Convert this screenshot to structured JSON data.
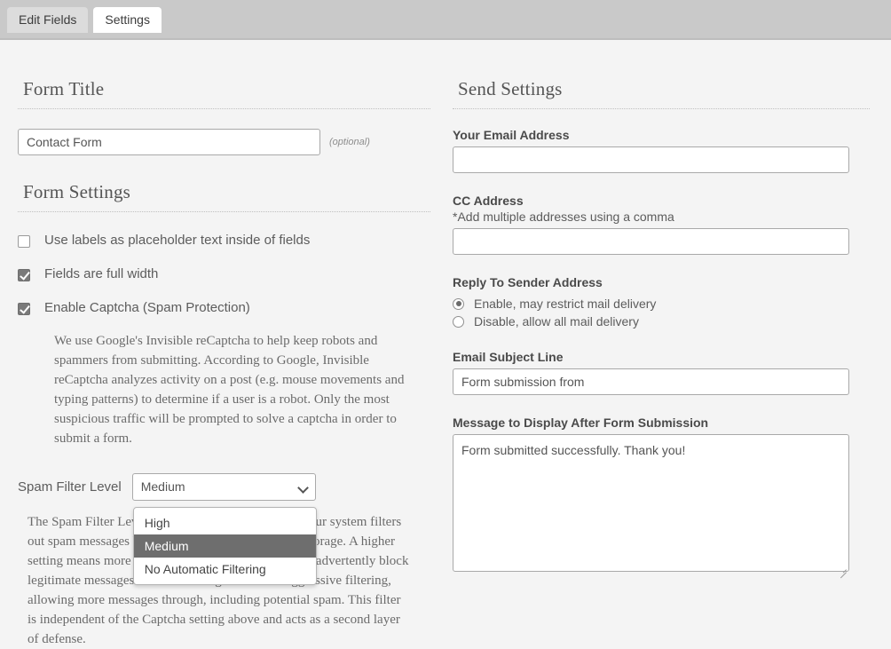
{
  "tabs": [
    {
      "label": "Edit Fields",
      "active": false
    },
    {
      "label": "Settings",
      "active": true
    }
  ],
  "left": {
    "form_title": {
      "heading": "Form Title",
      "value": "Contact Form",
      "optional_note": "(optional)"
    },
    "form_settings": {
      "heading": "Form Settings",
      "checkboxes": [
        {
          "label": "Use labels as placeholder text inside of fields",
          "checked": false
        },
        {
          "label": "Fields are full width",
          "checked": true
        },
        {
          "label": "Enable Captcha (Spam Protection)",
          "checked": true
        }
      ],
      "captcha_help": "We use Google's Invisible reCaptcha to help keep robots and spammers from submitting. According to Google, Invisible reCaptcha analyzes activity on a post (e.g. mouse movements and typing patterns) to determine if a user is a robot. Only the most suspicious traffic will be prompted to solve a captcha in order to submit a form.",
      "spam_filter": {
        "label": "Spam Filter Level",
        "selected": "Medium",
        "options": [
          "High",
          "Medium",
          "No Automatic Filtering"
        ],
        "open": true,
        "help": "The Spam Filter Level determines how aggressively our system filters out spam messages before they reach your inbox or storage. A higher setting means more aggressive filtering, which may inadvertently block legitimate messages. A lower setting means less aggressive filtering, allowing more messages through, including potential spam. This filter is independent of the Captcha setting above and acts as a second layer of defense."
      }
    }
  },
  "right": {
    "heading": "Send Settings",
    "your_email": {
      "label": "Your Email Address",
      "value": "",
      "placeholder": ""
    },
    "cc_address": {
      "label": "CC Address",
      "sub_label": "*Add multiple addresses using a comma",
      "value": "",
      "placeholder": ""
    },
    "reply_to": {
      "label": "Reply To Sender Address",
      "options": [
        {
          "label": "Enable, may restrict mail delivery",
          "selected": true
        },
        {
          "label": "Disable, allow all mail delivery",
          "selected": false
        }
      ]
    },
    "subject_line": {
      "label": "Email Subject Line",
      "value": "Form submission from"
    },
    "message": {
      "label": "Message to Display After Form Submission",
      "value": "Form submitted successfully. Thank you!"
    }
  },
  "colors": {
    "page_bg": "#f4f4f4",
    "tabbar_bg": "#c9c9c9",
    "tab_active_bg": "#ffffff",
    "tab_inactive_bg": "#dcdcdc",
    "checkbox_checked": "#7a7a7a",
    "dropdown_selected_bg": "#6e6e6e"
  }
}
